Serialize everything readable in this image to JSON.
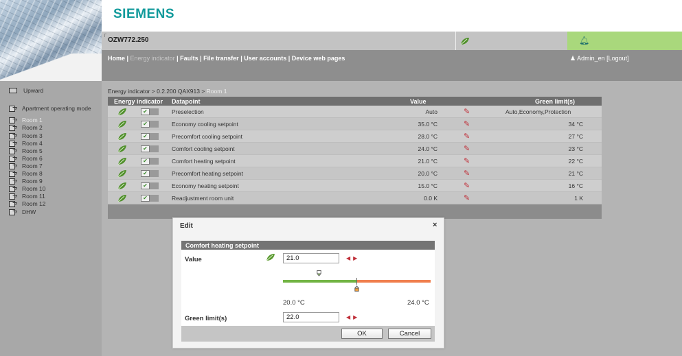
{
  "header": {
    "logo": "SIEMENS",
    "device_name": "OZW772.250",
    "nav": {
      "home": "Home",
      "energy_indicator": "Energy indicator",
      "faults": "Faults",
      "file_transfer": "File transfer",
      "user_accounts": "User accounts",
      "device_web_pages": "Device web pages",
      "sep": " | "
    },
    "user": "Admin_en",
    "logout": "[Logout]",
    "icons": {
      "energy": "leaf-icon",
      "alarm": "bell-icon",
      "user": "user-icon"
    }
  },
  "sidebar": {
    "upward": "Upward",
    "items": [
      {
        "label": "Apartment operating mode"
      },
      {
        "label": "Room 1",
        "selected": true
      },
      {
        "label": "Room 2"
      },
      {
        "label": "Room 3"
      },
      {
        "label": "Room 4"
      },
      {
        "label": "Room 5"
      },
      {
        "label": "Room 6"
      },
      {
        "label": "Room 7"
      },
      {
        "label": "Room 8"
      },
      {
        "label": "Room 9"
      },
      {
        "label": "Room 10"
      },
      {
        "label": "Room 11"
      },
      {
        "label": "Room 12"
      },
      {
        "label": "DHW"
      }
    ]
  },
  "breadcrumb": {
    "path": "Energy indicator > 0.2.200 QAX913 > ",
    "current": "Room 1"
  },
  "table": {
    "columns": {
      "energy_indicator": "Energy indicator",
      "datapoint": "Datapoint",
      "value": "Value",
      "green_limits": "Green limit(s)"
    },
    "rows": [
      {
        "datapoint": "Preselection",
        "value": "Auto",
        "green_limit": "Auto,Economy,Protection",
        "checked": true
      },
      {
        "datapoint": "Economy cooling setpoint",
        "value": "35.0 °C",
        "green_limit": "34 °C",
        "checked": true
      },
      {
        "datapoint": "Precomfort cooling setpoint",
        "value": "28.0 °C",
        "green_limit": "27 °C",
        "checked": true
      },
      {
        "datapoint": "Comfort cooling setpoint",
        "value": "24.0 °C",
        "green_limit": "23 °C",
        "checked": true
      },
      {
        "datapoint": "Comfort heating setpoint",
        "value": "21.0 °C",
        "green_limit": "22 °C",
        "checked": true
      },
      {
        "datapoint": "Precomfort heating setpoint",
        "value": "20.0 °C",
        "green_limit": "21 °C",
        "checked": true
      },
      {
        "datapoint": "Economy heating setpoint",
        "value": "15.0 °C",
        "green_limit": "16 °C",
        "checked": true
      },
      {
        "datapoint": "Readjustment room unit",
        "value": "0.0 K",
        "green_limit": "1 K",
        "checked": true
      }
    ]
  },
  "modal": {
    "title": "Edit",
    "close": "×",
    "section": "Comfort heating setpoint",
    "value_label": "Value",
    "value": "21.0",
    "green_limit_label": "Green limit(s)",
    "green_limit": "22.0",
    "range_min": "20.0 °C",
    "range_max": "24.0 °C",
    "arrow_left": "◀",
    "arrow_right": "▶",
    "ok": "OK",
    "cancel": "Cancel"
  },
  "colors": {
    "brand": "#119a9b",
    "green_bar": "#72b444",
    "orange_bar": "#f07f4e",
    "alarm_bg": "#a9d87c",
    "edit_icon": "#c0303a"
  }
}
